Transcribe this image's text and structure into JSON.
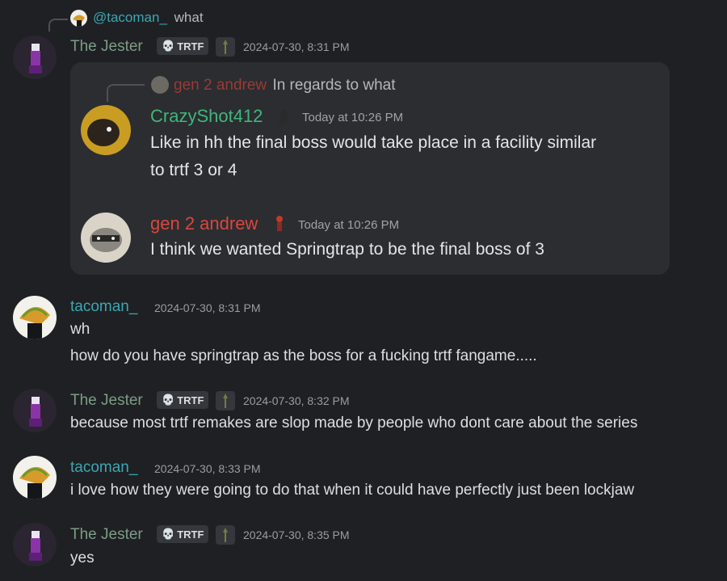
{
  "colors": {
    "background": "#1f2023",
    "embed_bg": "#2b2d31",
    "jester_name": "#7d9c86",
    "tacoman_name": "#3aa7b4",
    "crazyshot_name": "#3fb67c",
    "andrew_name": "#d9473c",
    "andrew_name_faded": "#9a3a33"
  },
  "top_reply": {
    "mention": "@tacoman_",
    "text": "what"
  },
  "messages": [
    {
      "author": "The Jester",
      "badge": "TRTF",
      "badge_icon": "skull-icon",
      "timestamp": "2024-07-30, 8:31 PM",
      "embed": {
        "reply": {
          "author": "gen 2 andrew",
          "text": "In regards to what"
        },
        "posts": [
          {
            "author": "CrazyShot412",
            "timestamp": "Today at 10:26 PM",
            "lines": [
              "Like in hh the final boss would take place in a facility similar",
              "to trtf 3 or 4"
            ]
          },
          {
            "author": "gen 2 andrew",
            "timestamp": "Today at 10:26 PM",
            "lines": [
              "I think we wanted Springtrap to be the final boss of 3"
            ]
          }
        ]
      }
    },
    {
      "author": "tacoman_",
      "timestamp": "2024-07-30, 8:31 PM",
      "lines": [
        "wh",
        "how do you have springtrap as the boss for a fucking trtf fangame....."
      ]
    },
    {
      "author": "The Jester",
      "badge": "TRTF",
      "timestamp": "2024-07-30, 8:32 PM",
      "lines": [
        "because most trtf remakes are slop made by people who dont care about the series"
      ]
    },
    {
      "author": "tacoman_",
      "timestamp": "2024-07-30, 8:33 PM",
      "lines": [
        "i love how they were going to do that when it could have perfectly just been lockjaw"
      ]
    },
    {
      "author": "The Jester",
      "badge": "TRTF",
      "timestamp": "2024-07-30, 8:35 PM",
      "lines": [
        "yes"
      ]
    }
  ]
}
